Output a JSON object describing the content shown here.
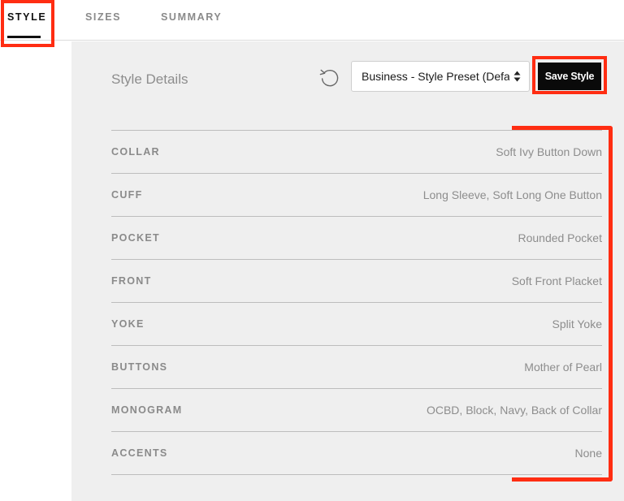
{
  "tabs": [
    {
      "label": "STYLE",
      "active": true
    },
    {
      "label": "SIZES",
      "active": false
    },
    {
      "label": "SUMMARY",
      "active": false
    }
  ],
  "panel": {
    "title": "Style Details",
    "preset_select": {
      "value": "Business - Style Preset (Default)"
    },
    "save_label": "Save Style"
  },
  "details": [
    {
      "label": "COLLAR",
      "value": "Soft Ivy Button Down"
    },
    {
      "label": "CUFF",
      "value": "Long Sleeve, Soft Long One Button"
    },
    {
      "label": "POCKET",
      "value": "Rounded Pocket"
    },
    {
      "label": "FRONT",
      "value": "Soft Front Placket"
    },
    {
      "label": "YOKE",
      "value": "Split Yoke"
    },
    {
      "label": "BUTTONS",
      "value": "Mother of Pearl"
    },
    {
      "label": "MONOGRAM",
      "value": "OCBD, Block, Navy, Back of Collar"
    },
    {
      "label": "ACCENTS",
      "value": "None"
    }
  ],
  "icons": {
    "reset": "reset-icon",
    "select": "select-arrows-icon"
  },
  "colors": {
    "highlight": "#ff2d12",
    "button": "#0a0a0a",
    "panel": "#efefef"
  }
}
